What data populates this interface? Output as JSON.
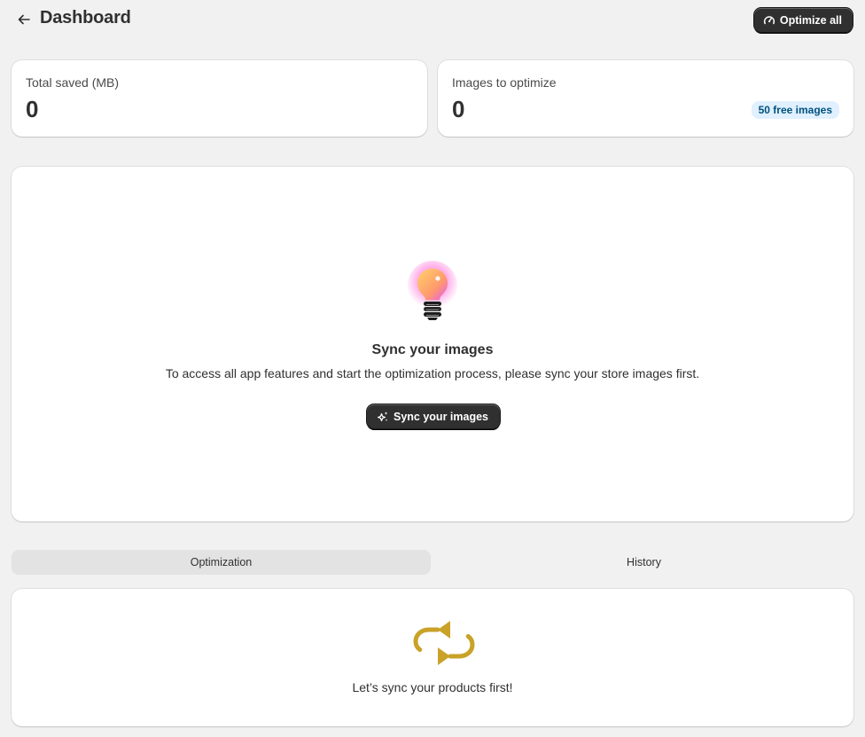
{
  "header": {
    "title": "Dashboard",
    "back_icon": "arrow-left-icon",
    "optimize_all_label": "Optimize all",
    "optimize_all_icon": "gauge-icon"
  },
  "stats": [
    {
      "label": "Total saved (MB)",
      "value": "0"
    },
    {
      "label": "Images to optimize",
      "value": "0",
      "badge": "50 free images"
    }
  ],
  "sync": {
    "icon": "lightbulb-icon",
    "title": "Sync your images",
    "description": "To access all app features and start the optimization process, please sync your store images first.",
    "button_label": "Sync your images",
    "button_icon": "sparkle-icon"
  },
  "tabs": [
    {
      "label": "Optimization",
      "active": true
    },
    {
      "label": "History",
      "active": false
    }
  ],
  "empty_state": {
    "icon": "sync-arrows-icon",
    "text": "Let’s sync your products first!"
  },
  "colors": {
    "background": "#f1f1f1",
    "primary_button": "#303030",
    "badge_bg": "#e0f0ff",
    "badge_text": "#00527c",
    "sync_icon": "#c9a227"
  }
}
